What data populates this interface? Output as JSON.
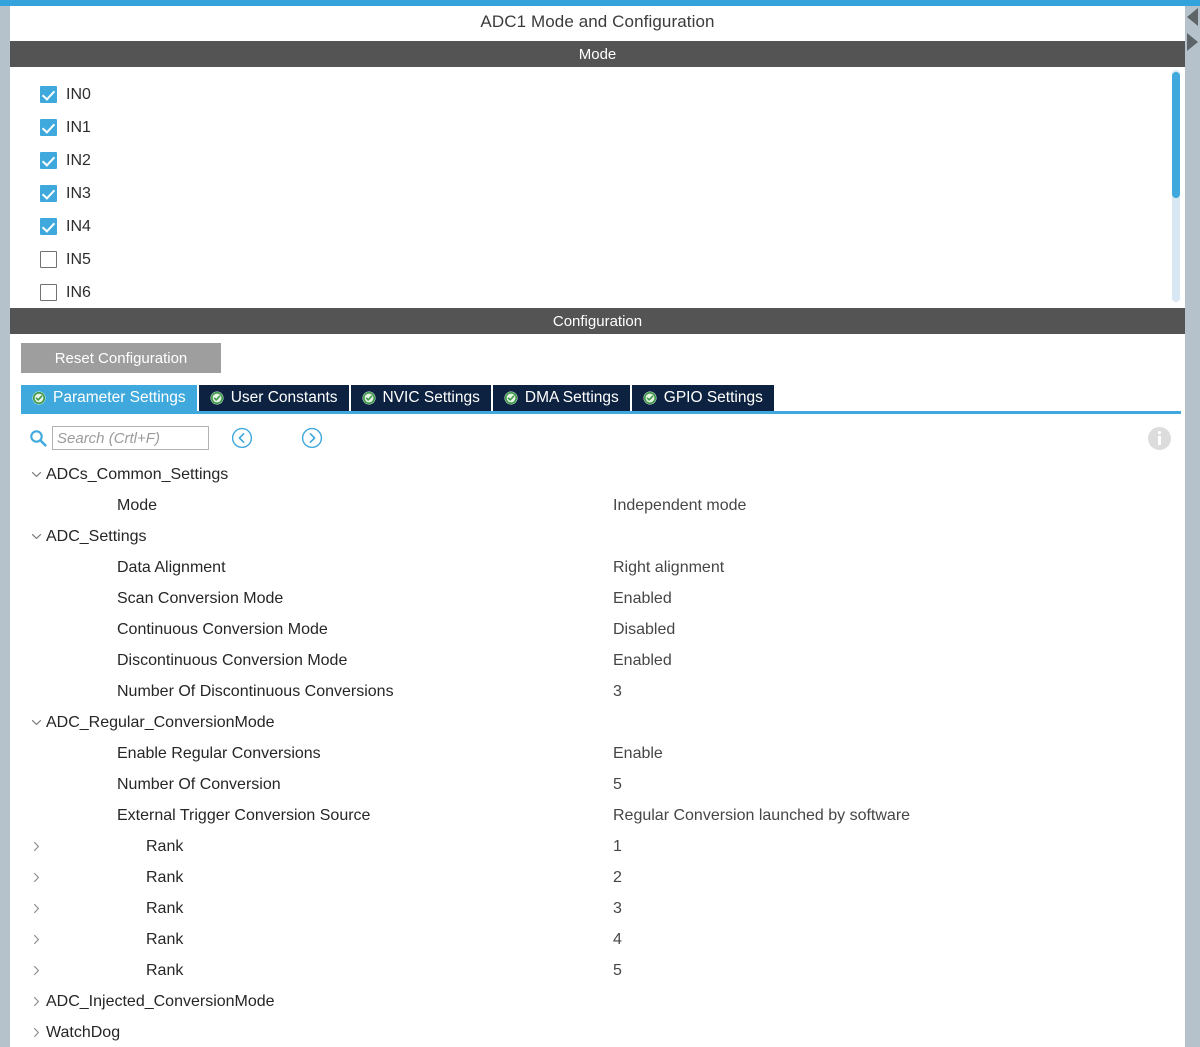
{
  "window": {
    "title": "ADC1 Mode and Configuration"
  },
  "edge_controls": {
    "collapse_left_icon": "triangle-left-icon",
    "expand_right_icon": "triangle-right-icon"
  },
  "mode_section": {
    "header": "Mode",
    "channels": [
      {
        "label": "IN0",
        "checked": true
      },
      {
        "label": "IN1",
        "checked": true
      },
      {
        "label": "IN2",
        "checked": true
      },
      {
        "label": "IN3",
        "checked": true
      },
      {
        "label": "IN4",
        "checked": true
      },
      {
        "label": "IN5",
        "checked": false
      },
      {
        "label": "IN6",
        "checked": false
      }
    ],
    "scrollbar": {
      "thumb_color": "#3fa9dd",
      "track_color": "#d9e7f2"
    }
  },
  "config_section": {
    "header": "Configuration",
    "reset_button": "Reset Configuration",
    "tabs": [
      {
        "label": "Parameter Settings",
        "active": true,
        "status_icon": "check-circle-icon"
      },
      {
        "label": "User Constants",
        "active": false,
        "status_icon": "check-circle-icon"
      },
      {
        "label": "NVIC Settings",
        "active": false,
        "status_icon": "check-circle-icon"
      },
      {
        "label": "DMA Settings",
        "active": false,
        "status_icon": "check-circle-icon"
      },
      {
        "label": "GPIO Settings",
        "active": false,
        "status_icon": "check-circle-icon"
      }
    ],
    "search": {
      "placeholder": "Search (Crtl+F)",
      "value": "",
      "icon": "search-icon",
      "prev_icon": "chevron-left-circle-icon",
      "next_icon": "chevron-right-circle-icon"
    },
    "info_icon": "info-circle-icon"
  },
  "parameters": [
    {
      "kind": "group",
      "expanded": true,
      "label": "ADCs_Common_Settings",
      "value": ""
    },
    {
      "kind": "item",
      "expanded": null,
      "label": "Mode",
      "value": "Independent mode"
    },
    {
      "kind": "group",
      "expanded": true,
      "label": "ADC_Settings",
      "value": ""
    },
    {
      "kind": "item",
      "expanded": null,
      "label": "Data Alignment",
      "value": "Right alignment"
    },
    {
      "kind": "item",
      "expanded": null,
      "label": "Scan Conversion Mode",
      "value": "Enabled"
    },
    {
      "kind": "item",
      "expanded": null,
      "label": "Continuous Conversion Mode",
      "value": "Disabled"
    },
    {
      "kind": "item",
      "expanded": null,
      "label": "Discontinuous Conversion Mode",
      "value": "Enabled"
    },
    {
      "kind": "item",
      "expanded": null,
      "label": "Number Of Discontinuous Conversions",
      "value": "3"
    },
    {
      "kind": "group",
      "expanded": true,
      "label": "ADC_Regular_ConversionMode",
      "value": ""
    },
    {
      "kind": "item",
      "expanded": null,
      "label": "Enable Regular Conversions",
      "value": "Enable"
    },
    {
      "kind": "item",
      "expanded": null,
      "label": "Number Of Conversion",
      "value": "5"
    },
    {
      "kind": "item",
      "expanded": null,
      "label": "External Trigger Conversion Source",
      "value": "Regular Conversion launched by software"
    },
    {
      "kind": "sub",
      "expanded": false,
      "label": "Rank",
      "value": "1"
    },
    {
      "kind": "sub",
      "expanded": false,
      "label": "Rank",
      "value": "2"
    },
    {
      "kind": "sub",
      "expanded": false,
      "label": "Rank",
      "value": "3"
    },
    {
      "kind": "sub",
      "expanded": false,
      "label": "Rank",
      "value": "4"
    },
    {
      "kind": "sub",
      "expanded": false,
      "label": "Rank",
      "value": "5"
    },
    {
      "kind": "group",
      "expanded": false,
      "label": "ADC_Injected_ConversionMode",
      "value": ""
    },
    {
      "kind": "group",
      "expanded": false,
      "label": "WatchDog",
      "value": ""
    }
  ],
  "theme": {
    "accent": "#3fa9dd",
    "header_bar": "#545454",
    "tab_inactive": "#0d2240",
    "gutter": "#b6c2cb",
    "reset_button": "#9e9e9e"
  }
}
